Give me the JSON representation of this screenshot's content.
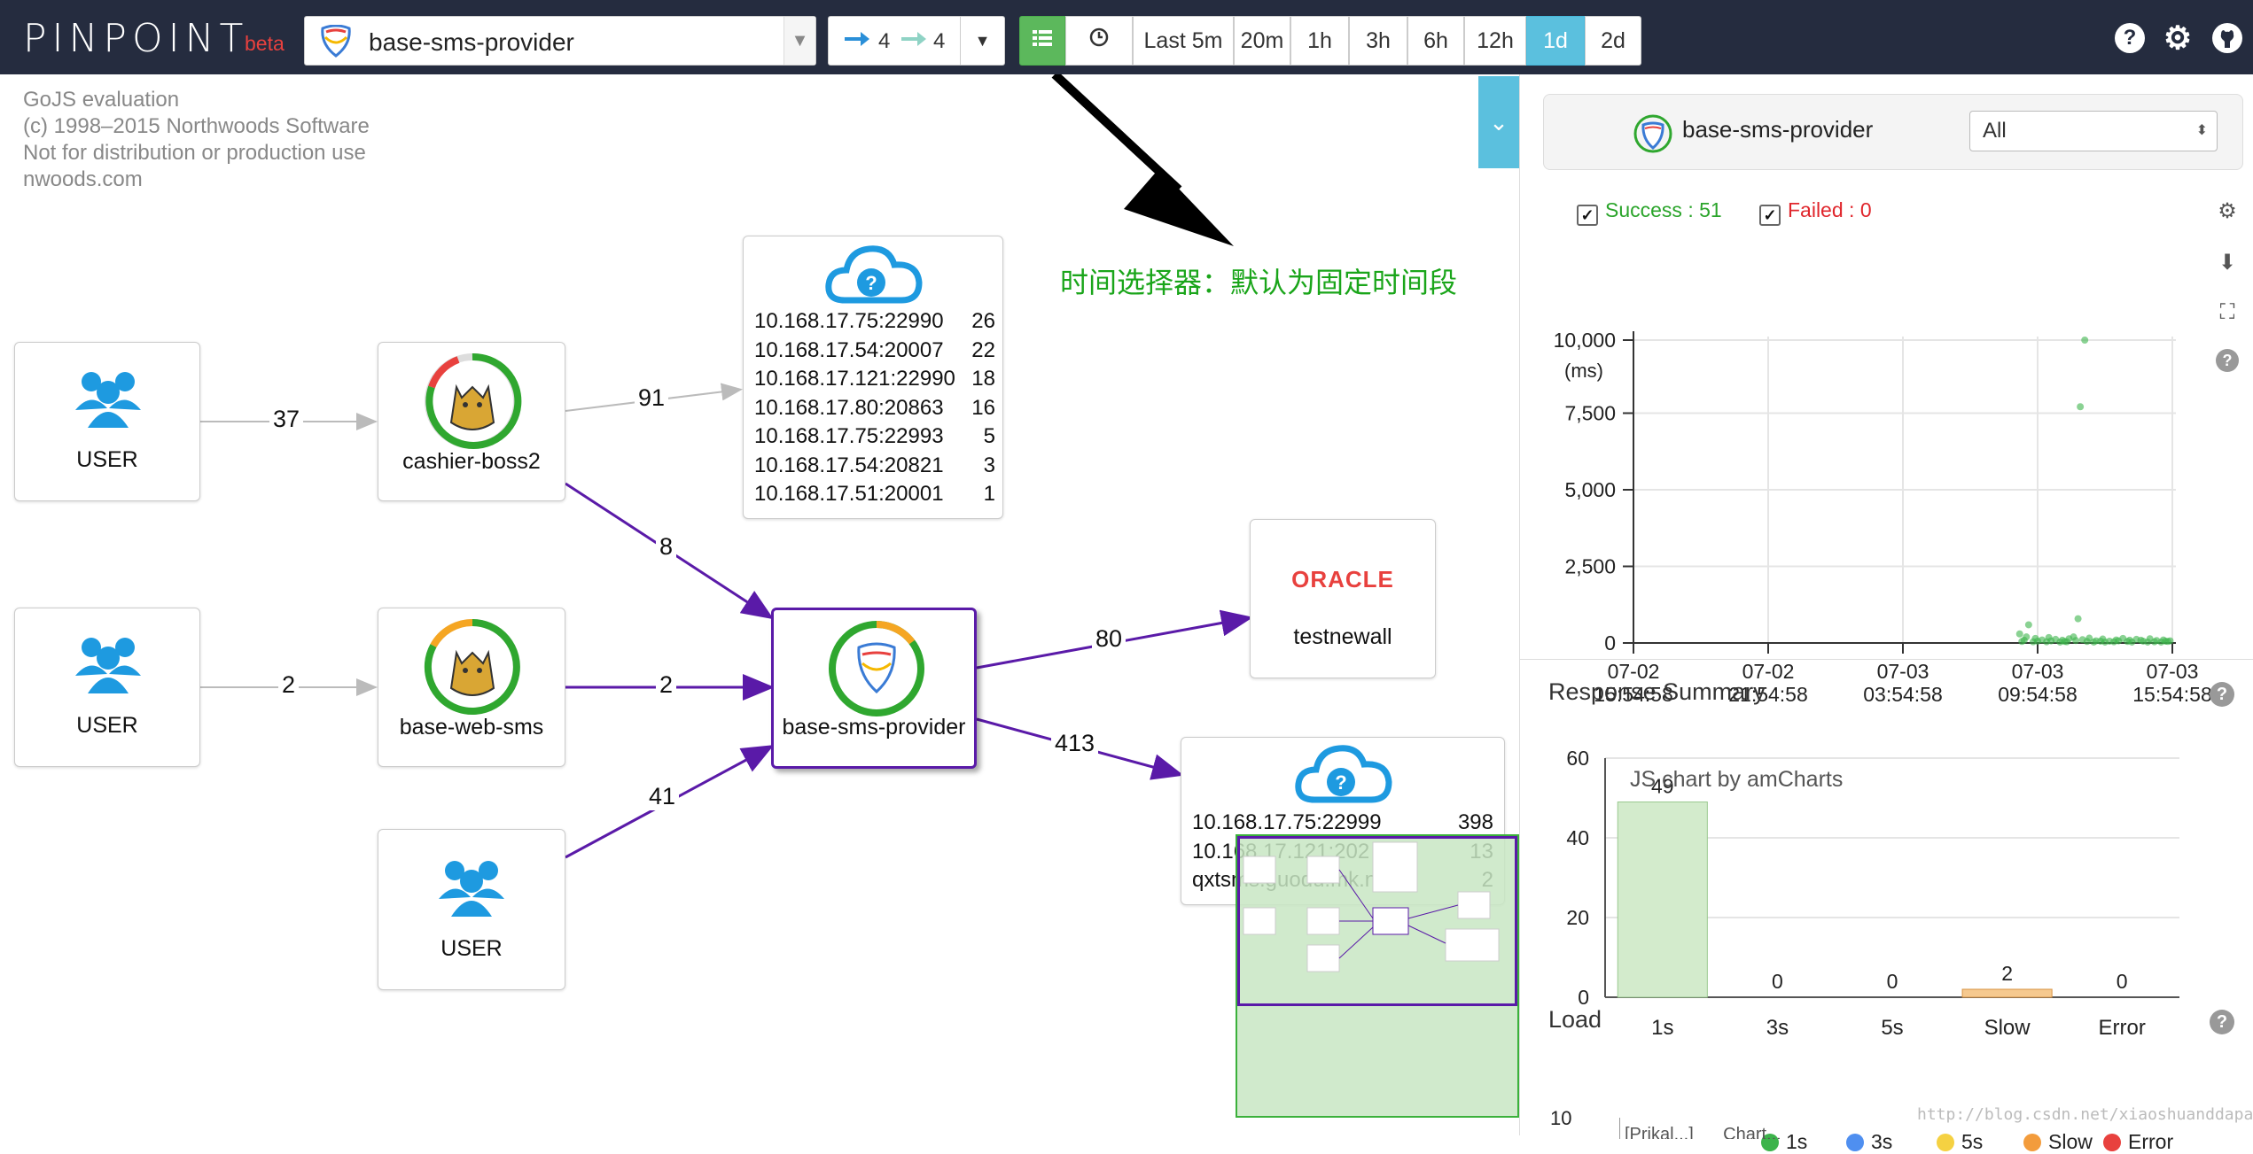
{
  "topbar": {
    "logo": "PINPOINT",
    "logo_badge": "beta",
    "app_name": "base-sms-provider",
    "inbound_depth": "4",
    "outbound_depth": "4",
    "time_buttons": [
      "Last 5m",
      "20m",
      "1h",
      "3h",
      "6h",
      "12h",
      "1d",
      "2d"
    ],
    "active_time": "1d",
    "icons": [
      "help-icon",
      "gear-icon",
      "github-icon"
    ]
  },
  "watermark": [
    "GoJS evaluation",
    "(c) 1998–2015 Northwoods Software",
    "Not for distribution or production use",
    "nwoods.com"
  ],
  "annotation": "时间选择器：默认为固定时间段",
  "servermap": {
    "nodes": {
      "user1": "USER",
      "user2": "USER",
      "user3": "USER",
      "cashier": "cashier-boss2",
      "webSms": "base-web-sms",
      "provider": "base-sms-provider",
      "oracle_logo": "ORACLE",
      "oracle": "testnewall"
    },
    "edges": {
      "u1_cashier": "37",
      "cashier_unknown1": "91",
      "cashier_provider": "8",
      "u2_websms": "2",
      "websms_provider": "2",
      "u3_provider": "41",
      "provider_oracle": "80",
      "provider_unknown2": "413"
    },
    "unknown1": [
      {
        "host": "10.168.17.75:22990",
        "count": "26"
      },
      {
        "host": "10.168.17.54:20007",
        "count": "22"
      },
      {
        "host": "10.168.17.121:22990",
        "count": "18"
      },
      {
        "host": "10.168.17.80:20863",
        "count": "16"
      },
      {
        "host": "10.168.17.75:22993",
        "count": "5"
      },
      {
        "host": "10.168.17.54:20821",
        "count": "3"
      },
      {
        "host": "10.168.17.51:20001",
        "count": "1"
      }
    ],
    "unknown2": [
      {
        "host": "10.168.17.75:22999",
        "count": "398"
      },
      {
        "host": "10.168.17.121:202",
        "count": "13"
      },
      {
        "host": "qxtsms.guodu.mk.n   000",
        "count": "2"
      }
    ]
  },
  "rightpanel": {
    "app_name": "base-sms-provider",
    "agent_select": "All",
    "success_label": "Success : 51",
    "failed_label": "Failed : 0",
    "colors": {
      "success": "#2aa42a",
      "failed": "#e0262c",
      "accent": "#5bc0de"
    },
    "response_summary_title": "Response Summary",
    "amcharts_credit": "JS chart by amCharts",
    "load_title": "Load",
    "load_y_first_tick": "10",
    "load_legend": [
      "1s",
      "3s",
      "5s",
      "Slow",
      "Error"
    ],
    "load_legend_colors": [
      "#3cb44b",
      "#4f8ff0",
      "#f5d142",
      "#f39c3c",
      "#e8413e"
    ],
    "load_table_partial": [
      "[Prikal...]",
      "Chart..."
    ],
    "footer_watermark": "http://blog.csdn.net/xiaoshuanddapang"
  },
  "chart_data": [
    {
      "type": "scatter",
      "title": "",
      "ylabel": "(ms)",
      "ylim": [
        0,
        10000
      ],
      "yticks": [
        "0",
        "2,500",
        "5,000",
        "7,500",
        "10,000"
      ],
      "xticks": [
        [
          "07-02",
          "15:54:58"
        ],
        [
          "07-02",
          "21:54:58"
        ],
        [
          "07-03",
          "03:54:58"
        ],
        [
          "07-03",
          "09:54:58"
        ],
        [
          "07-03",
          "15:54:58"
        ]
      ],
      "x_hours": [
        0,
        24
      ],
      "points": [
        {
          "x": 20.1,
          "y": 10000
        },
        {
          "x": 19.9,
          "y": 7800
        },
        {
          "x": 19.8,
          "y": 800
        },
        {
          "x": 17.6,
          "y": 600
        },
        {
          "x": 17.2,
          "y": 300
        },
        {
          "x": 17.5,
          "y": 200
        },
        {
          "x": 17.9,
          "y": 150
        },
        {
          "x": 18.2,
          "y": 100
        },
        {
          "x": 18.5,
          "y": 180
        },
        {
          "x": 18.8,
          "y": 120
        },
        {
          "x": 19.1,
          "y": 90
        },
        {
          "x": 19.4,
          "y": 140
        },
        {
          "x": 19.7,
          "y": 80
        },
        {
          "x": 20.0,
          "y": 110
        },
        {
          "x": 20.3,
          "y": 160
        },
        {
          "x": 20.6,
          "y": 70
        },
        {
          "x": 20.9,
          "y": 130
        },
        {
          "x": 21.2,
          "y": 60
        },
        {
          "x": 21.5,
          "y": 100
        },
        {
          "x": 21.8,
          "y": 150
        },
        {
          "x": 22.1,
          "y": 90
        },
        {
          "x": 22.4,
          "y": 120
        },
        {
          "x": 22.7,
          "y": 60
        },
        {
          "x": 23.0,
          "y": 140
        },
        {
          "x": 23.3,
          "y": 80
        },
        {
          "x": 23.6,
          "y": 100
        },
        {
          "x": 23.9,
          "y": 70
        },
        {
          "x": 17.4,
          "y": 90
        },
        {
          "x": 18.0,
          "y": 60
        },
        {
          "x": 18.6,
          "y": 70
        },
        {
          "x": 19.2,
          "y": 50
        },
        {
          "x": 19.6,
          "y": 200
        },
        {
          "x": 20.2,
          "y": 50
        },
        {
          "x": 20.8,
          "y": 60
        },
        {
          "x": 21.4,
          "y": 40
        },
        {
          "x": 22.0,
          "y": 50
        },
        {
          "x": 22.6,
          "y": 90
        },
        {
          "x": 23.2,
          "y": 40
        },
        {
          "x": 23.8,
          "y": 50
        },
        {
          "x": 17.8,
          "y": 40
        },
        {
          "x": 18.4,
          "y": 40
        },
        {
          "x": 19.0,
          "y": 30
        },
        {
          "x": 21.0,
          "y": 30
        },
        {
          "x": 21.6,
          "y": 70
        },
        {
          "x": 22.2,
          "y": 30
        },
        {
          "x": 22.9,
          "y": 30
        },
        {
          "x": 23.5,
          "y": 30
        },
        {
          "x": 17.3,
          "y": 50
        },
        {
          "x": 20.5,
          "y": 30
        },
        {
          "x": 23.7,
          "y": 60
        },
        {
          "x": 19.3,
          "y": 40
        }
      ],
      "grid": true
    },
    {
      "type": "bar",
      "title": "Response Summary",
      "categories": [
        "1s",
        "3s",
        "5s",
        "Slow",
        "Error"
      ],
      "values": [
        49,
        0,
        0,
        2,
        0
      ],
      "colors": [
        "#d3ebcc",
        "#cfe0f7",
        "#fbeec0",
        "#f6c98f",
        "#f5b5b5"
      ],
      "ylim": [
        0,
        60
      ],
      "yticks": [
        "0",
        "20",
        "40",
        "60"
      ],
      "grid": true
    }
  ]
}
